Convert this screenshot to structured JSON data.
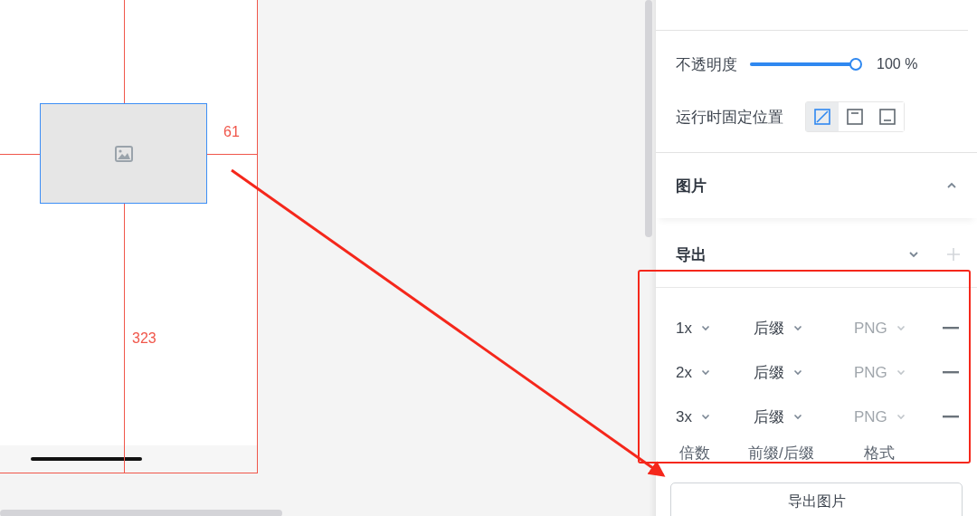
{
  "canvas": {
    "measurements": [
      {
        "kind": "horizontal",
        "label": "61"
      },
      {
        "kind": "vertical",
        "label": "323"
      }
    ]
  },
  "panel": {
    "opacity": {
      "label": "不透明度",
      "level": 1,
      "reading": "100 %"
    },
    "fixed_position": {
      "label": "运行时固定位置",
      "options": [
        {
          "kind": "none",
          "selected": true
        },
        {
          "kind": "top",
          "selected": false
        },
        {
          "kind": "bottom",
          "selected": false
        }
      ]
    },
    "image_section": {
      "title": "图片"
    },
    "export_section": {
      "title": "导出",
      "rows": [
        {
          "scale": "1x",
          "suffix": "后缀",
          "format": "PNG"
        },
        {
          "scale": "2x",
          "suffix": "后缀",
          "format": "PNG"
        },
        {
          "scale": "3x",
          "suffix": "后缀",
          "format": "PNG"
        }
      ],
      "column_labels": [
        "倍数",
        "前缀/后缀",
        "格式"
      ],
      "button": "导出图片"
    }
  }
}
